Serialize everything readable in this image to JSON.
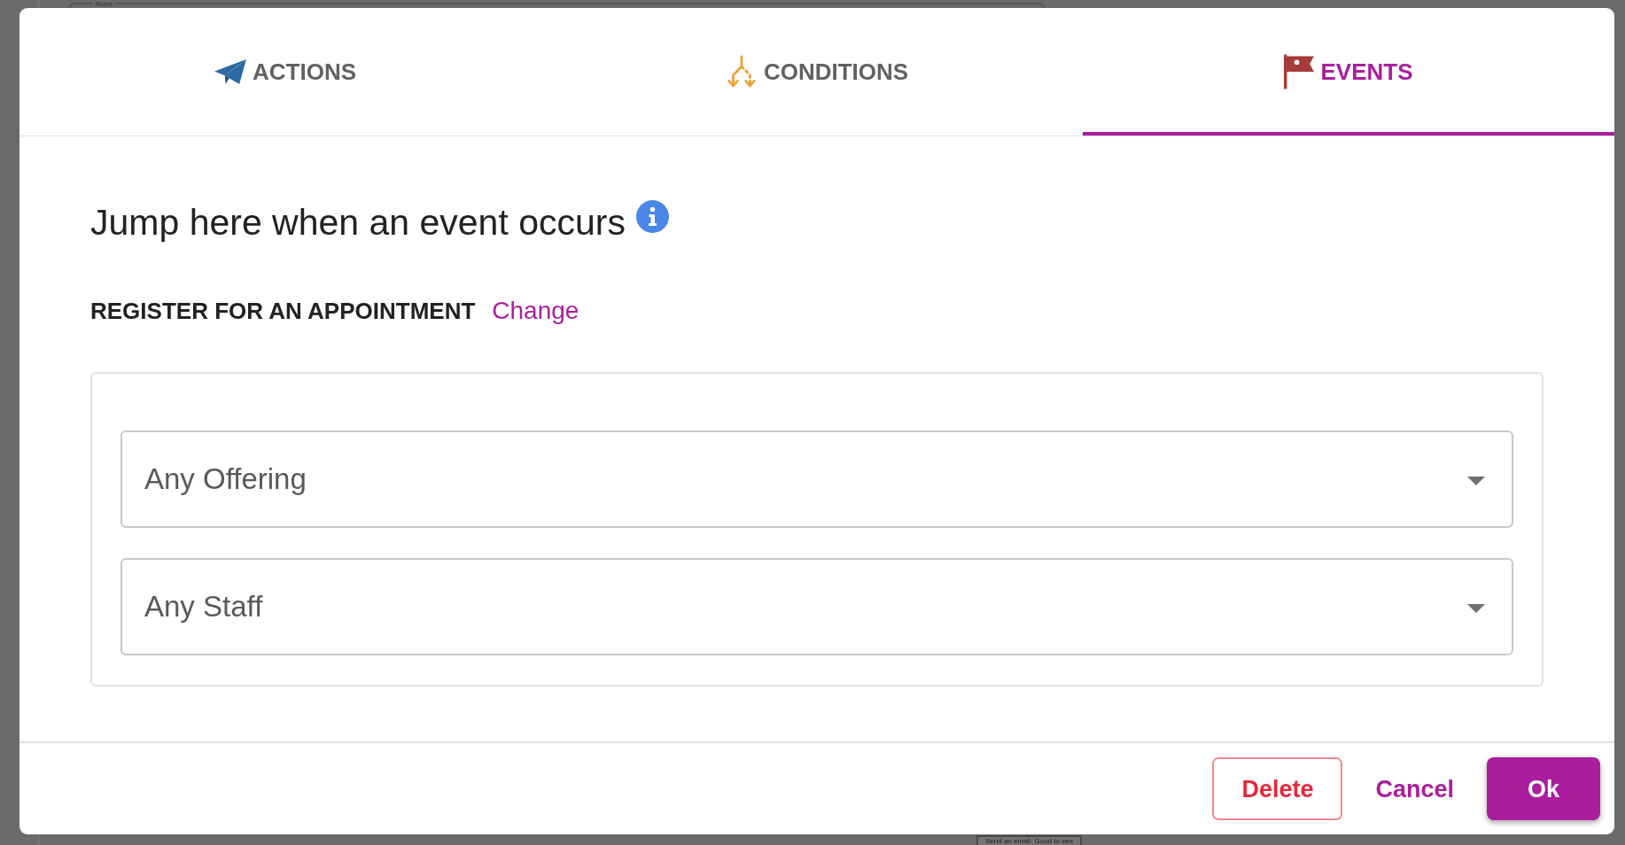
{
  "background": {
    "panel_title": "Runs",
    "node_label": "Send an email: Good to see"
  },
  "dialog": {
    "tabs": [
      {
        "label": "ACTIONS",
        "selected": false
      },
      {
        "label": "CONDITIONS",
        "selected": false
      },
      {
        "label": "EVENTS",
        "selected": true
      }
    ],
    "heading": "Jump here when an event occurs",
    "event": {
      "name": "REGISTER FOR AN APPOINTMENT",
      "change_link": "Change"
    },
    "filters": [
      {
        "value": "Any Offering"
      },
      {
        "value": "Any Staff"
      }
    ],
    "buttons": [
      {
        "label": "Delete",
        "kind": "danger"
      },
      {
        "label": "Cancel",
        "kind": "link"
      },
      {
        "label": "Ok",
        "kind": "primary"
      }
    ]
  }
}
